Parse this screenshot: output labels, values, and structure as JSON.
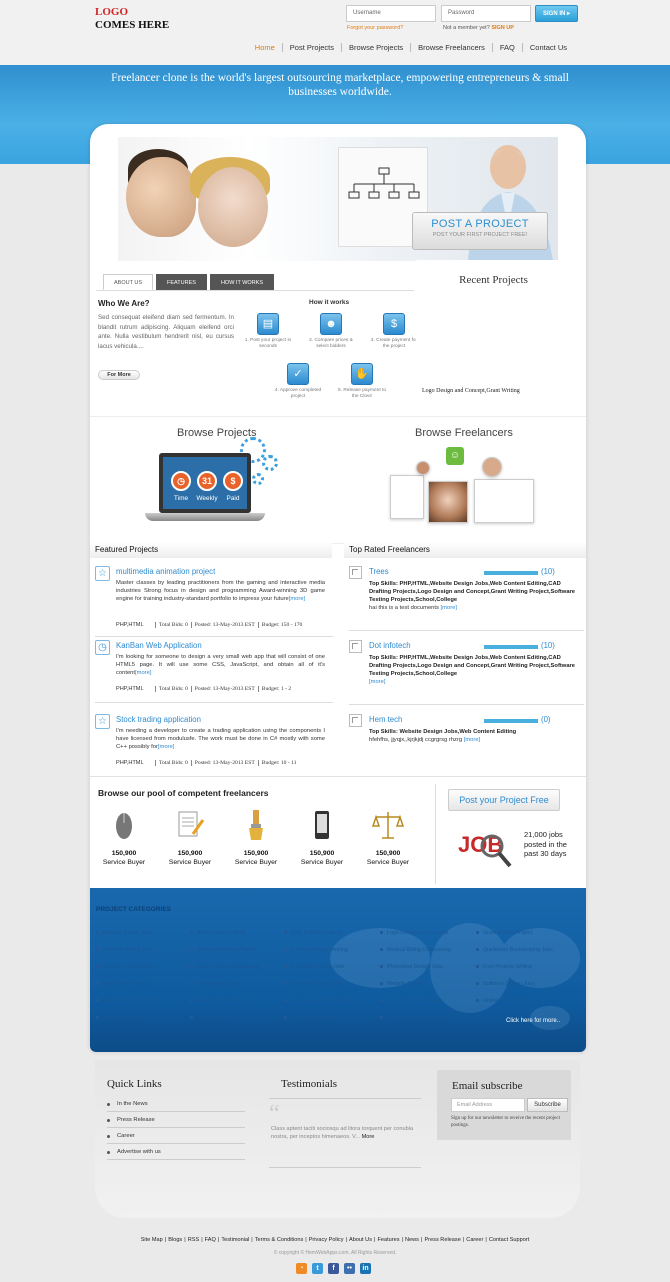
{
  "logo": {
    "line1": "LOGO",
    "line2": "COMES HERE"
  },
  "login": {
    "username_placeholder": "Username",
    "password_placeholder": "Password",
    "signin_label": "SIGN IN",
    "forgot_label": "Forgot your password?",
    "member_text": "Not a member yet?",
    "signup_label": "SIGN UP"
  },
  "nav": [
    "Home",
    "Post Projects",
    "Browse Projects",
    "Browse Freelancers",
    "FAQ",
    "Contact Us"
  ],
  "banner": {
    "text": "Freelancer clone is the world's largest outsourcing marketplace, empowering entrepreneurs & small businesses worldwide."
  },
  "hero": {
    "post_title": "POST A PROJECT",
    "post_subtitle": "POST YOUR FIRST PROJECT FREE!"
  },
  "tabs": [
    "ABOUT US",
    "FEATURES",
    "HOW IT WORKS"
  ],
  "about": {
    "title": "Who We Are?",
    "text": "Sed consequat eleifend diam sed fermentum. In blandit rutrum adipiscing. Aliquam eleifend orci ante. Nulla vestibulum hendrerit nisl, eu cursus lacus vehicula....",
    "more_label": "For More"
  },
  "how_it_works": {
    "title": "How it works",
    "steps": [
      {
        "label": "1. Post your project in seconds",
        "icon": "document-icon"
      },
      {
        "label": "2. Compare prices & select bidders",
        "icon": "people-icon"
      },
      {
        "label": "3. Create payment for the project",
        "icon": "dollar-icon"
      },
      {
        "label": "4. Approve completed project",
        "icon": "check-icon"
      },
      {
        "label": "5. Release payment to the Clovir",
        "icon": "hand-icon"
      }
    ]
  },
  "recent_projects": {
    "title": "Recent Projects",
    "item": "Logo Design and Concept,Grant Writing"
  },
  "browse": {
    "projects_title": "Browse Projects",
    "freelancers_title": "Browse Freelancers",
    "circles": [
      "Time",
      "Weekly",
      "Paid"
    ]
  },
  "featured": {
    "title": "Featured Projects",
    "items": [
      {
        "title": "multimedia animation project",
        "desc": "Master classes by leading practitioners from the gaming and interactive media industries Strong focus in design and programming Award-winning 3D game engine for training industry-standard portfolio to impress your future",
        "more": "[more]",
        "tags": "PHP,HTML",
        "bids": "Total Bids: 0",
        "posted": "Posted: 13-May-2013 EST",
        "budget": "Budget: 150 - 170"
      },
      {
        "title": "KanBan Web Application",
        "desc": "I'm looking for someone to design a very small web app that will consist of one HTML5 page. It will use some CSS, JavaScript, and obtain all of it's content",
        "more": "[more]",
        "tags": "PHP,HTML",
        "bids": "Total Bids: 0",
        "posted": "Posted: 13-May-2013 EST",
        "budget": "Budget: 1 - 2"
      },
      {
        "title": "Stock trading application",
        "desc": "I'm needing a developer to create a trading application using the components I have licensed from modulusfe. The work must be done in C# mostly with some C++ possibly for",
        "more": "[more]",
        "tags": "PHP,HTML",
        "bids": "Total Bids: 0",
        "posted": "Posted: 13-May-2013 EST",
        "budget": "Budget: 10 - 11"
      }
    ]
  },
  "top_rated": {
    "title": "Top Rated Freelancers",
    "items": [
      {
        "name": "Trees",
        "count": "(10)",
        "rating": 1.0,
        "skills_label": "Top Skills:",
        "skills": "PHP,HTML,Website Design Jobs,Web Content Editing,CAD Drafting Projects,Logo Design and Concept,Grant Writing Project,Software Testing Projects,School,College",
        "desc": "hai this is a test documents",
        "more": "[more]"
      },
      {
        "name": "Dot infotech",
        "count": "(10)",
        "rating": 1.0,
        "skills_label": "Top Skills:",
        "skills": "PHP,HTML,Website Design Jobs,Web Content Editing,CAD Drafting Projects,Logo Design and Concept,Grant Writing Project,Software Testing Projects,School,College",
        "desc": "",
        "more": "[more]"
      },
      {
        "name": "Hem tech",
        "count": "(0)",
        "rating": 1.0,
        "skills_label": "Top Skills:",
        "skills": "Website Design Jobs,Web Content Editing",
        "desc": "hfehfhs, jjyqjx,,kjrjkjdj ccgrgrsg rhzrg",
        "more": "[more]"
      }
    ]
  },
  "pool": {
    "title": "Browse our pool of competent freelancers",
    "items": [
      {
        "count": "150,900",
        "label": "Service Buyer",
        "icon": "mouse-icon"
      },
      {
        "count": "150,900",
        "label": "Service Buyer",
        "icon": "document-pencil-icon"
      },
      {
        "count": "150,900",
        "label": "Service Buyer",
        "icon": "paint-brush-icon"
      },
      {
        "count": "150,900",
        "label": "Service Buyer",
        "icon": "mobile-phone-icon"
      },
      {
        "count": "150,900",
        "label": "Service Buyer",
        "icon": "scales-icon"
      }
    ]
  },
  "post_free": {
    "label": "Post your Project Free",
    "jobs_text": "21,000 jobs posted in the past 30 days",
    "badge": "JOB"
  },
  "categories": {
    "title": "PROJECT CATEGORIES",
    "columns": [
      [
        "Website Design Jobs",
        "Creative Writing Jobs",
        "Graphic Presentation",
        "Flex Flash Projects",
        "Software Programming",
        "Software Projects"
      ],
      [
        "Web Content Editing",
        "Software Testing Projects",
        "Web Services Outsourcing",
        "3D Animation Jobs",
        "JavaScript Design Jobs",
        "Virtual Rangers"
      ],
      [
        "CAD Drafting Projects",
        "Freelance Programming",
        "Ecommerce Web Jobs",
        "Illustrator Graphic Jobs",
        "Wordpress Jobs Freelance",
        "IPhone Development"
      ],
      [
        "Logo Design and Concept",
        "Medical Billing Outsourcing",
        "Photoshop Design Jobs",
        "Website Projects",
        "Search Engine Projects",
        "Excel Entry Outsourcing"
      ],
      [
        "Grant Writing Project",
        "Quickbook Bookkeeping Jobs",
        "Free Projects Writing",
        "Software Design Jobs",
        "Online Writing Projects"
      ]
    ],
    "click_more": "Click here for more.."
  },
  "quick_links": {
    "title": "Quick Links",
    "items": [
      "In the News",
      "Press Release",
      "Career",
      "Advertise with us"
    ]
  },
  "testimonials": {
    "title": "Testimonials",
    "text": "Class aptent taciti sociosqu ad litora torquent per conubia nostra, per inceptos himenaeos. V...",
    "more": "More"
  },
  "subscribe": {
    "title": "Email subscribe",
    "placeholder": "Email Address",
    "button": "Subscribe",
    "note": "Sign up for our newsletter to receive the recent project postings."
  },
  "footer": {
    "links": [
      "Site Map",
      "Blogs",
      "RSS",
      "FAQ",
      "Testimonial",
      "Terms & Conditions",
      "Privacy Policy",
      "About Us",
      "Features",
      "News",
      "Press Release",
      "Career",
      "Contact Support"
    ],
    "copyright": "© copyright © HemWebApps.com. All Rights Reserved.",
    "social": [
      {
        "name": "rss-icon",
        "glyph": "◔",
        "color": "#f08a24"
      },
      {
        "name": "twitter-icon",
        "glyph": "t",
        "color": "#3a9ad9"
      },
      {
        "name": "facebook-icon",
        "glyph": "f",
        "color": "#3b5998"
      },
      {
        "name": "flickr-icon",
        "glyph": "••",
        "color": "#3d6fb0"
      },
      {
        "name": "linkedin-icon",
        "glyph": "in",
        "color": "#1a74b3"
      }
    ]
  },
  "colors": {
    "accent": "#2e8bd1",
    "orange": "#e07b10",
    "banner": "#3aa3df",
    "categories_bg": "#1462a6"
  }
}
